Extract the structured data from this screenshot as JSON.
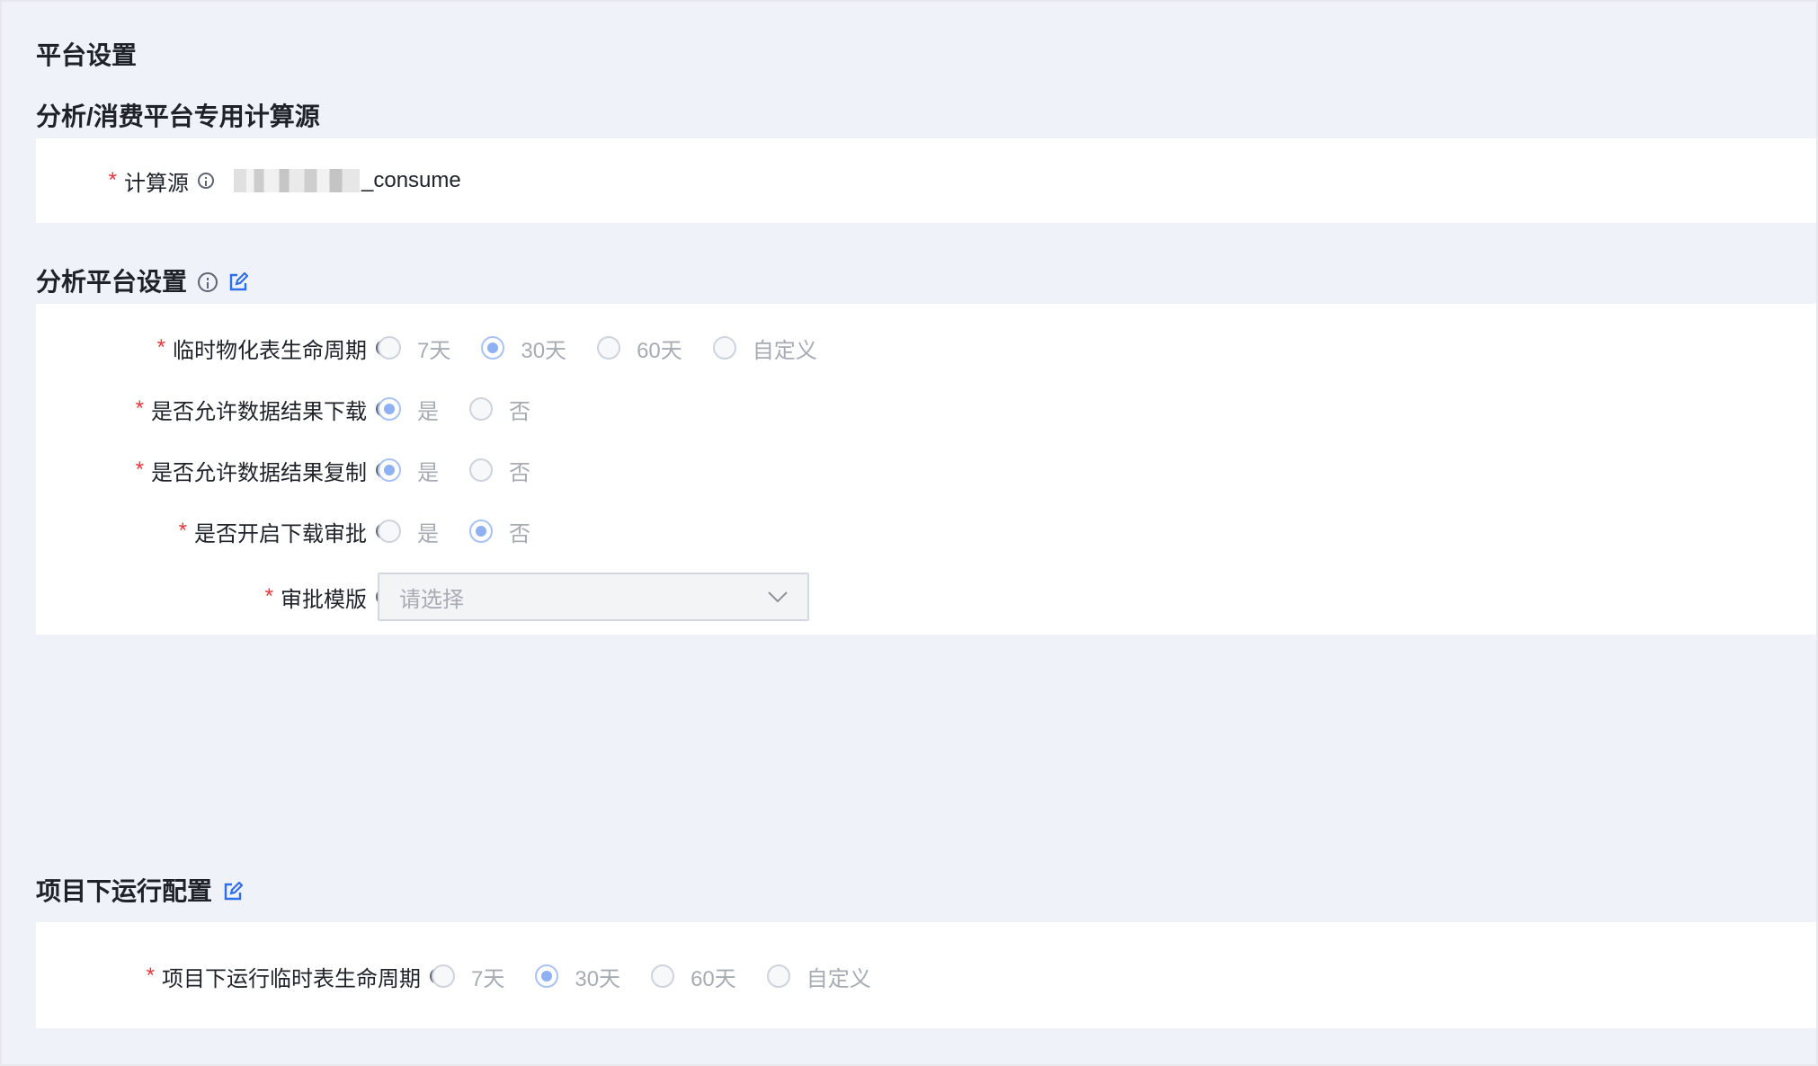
{
  "page_title": "平台设置",
  "compute_section": {
    "title": "分析/消费平台专用计算源",
    "field_label": "计算源",
    "field_value_suffix": "_consume"
  },
  "analysis_section": {
    "title": "分析平台设置",
    "fields": [
      {
        "label": "临时物化表生命周期",
        "options": [
          "7天",
          "30天",
          "60天",
          "自定义"
        ],
        "selected": "30天"
      },
      {
        "label": "是否允许数据结果下载",
        "options": [
          "是",
          "否"
        ],
        "selected": "是"
      },
      {
        "label": "是否允许数据结果复制",
        "options": [
          "是",
          "否"
        ],
        "selected": "是"
      },
      {
        "label": "是否开启下载审批",
        "options": [
          "是",
          "否"
        ],
        "selected": "否"
      }
    ],
    "template": {
      "label": "审批模版",
      "placeholder": "请选择"
    }
  },
  "project_section": {
    "title": "项目下运行配置",
    "field": {
      "label": "项目下运行临时表生命周期",
      "options": [
        "7天",
        "30天",
        "60天",
        "自定义"
      ],
      "selected": "30天"
    }
  },
  "required_mark": "*",
  "colors": {
    "accent": "#2f6ee8",
    "required": "#e5363d",
    "background": "#f0f2f9"
  },
  "icons": {
    "info": "info-icon",
    "edit": "edit-icon",
    "dropdown": "chevron-down-icon"
  }
}
